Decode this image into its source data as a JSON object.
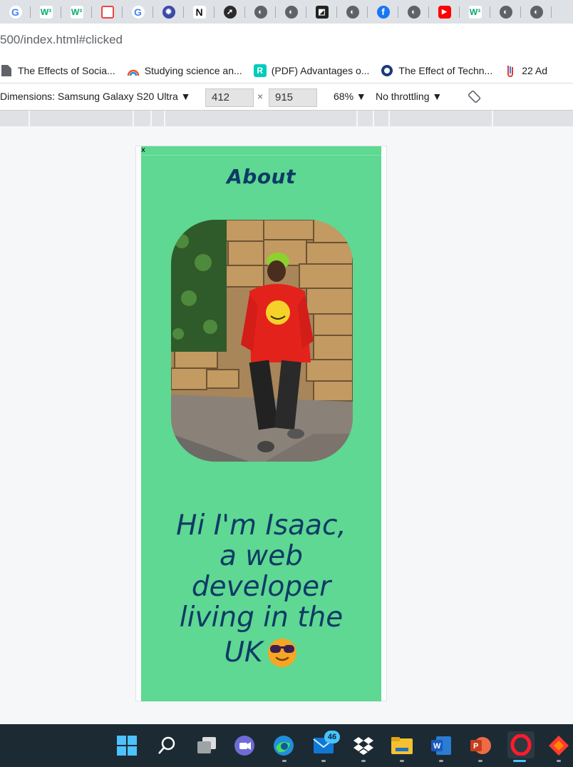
{
  "browser": {
    "url": "500/index.html#clicked",
    "tabs_icons": [
      "g-icon",
      "w3schools-icon",
      "w3schools-icon",
      "grid-icon",
      "google-icon",
      "gear-icon",
      "notion-icon",
      "dark-app-icon",
      "globe-icon",
      "globe-icon",
      "square-app-icon",
      "globe-icon",
      "facebook-icon",
      "globe-icon",
      "youtube-icon",
      "w3schools-icon",
      "globe-icon",
      "globe-icon",
      "globe-icon"
    ],
    "bookmarks": [
      {
        "label": "The Effects of Socia..."
      },
      {
        "label": "Studying science an..."
      },
      {
        "label": "(PDF) Advantages o..."
      },
      {
        "label": "The Effect of Techn..."
      },
      {
        "label": "22 Ad"
      }
    ]
  },
  "devtools": {
    "dimensions_label": "Dimensions: Samsung Galaxy S20 Ultra ▼",
    "width": "412",
    "times": "×",
    "height": "915",
    "zoom": "68% ▼",
    "throttling": "No throttling ▼"
  },
  "page": {
    "close_label": "x",
    "heading": "About",
    "hero_lines": [
      "Hi I'm Isaac,",
      "a web",
      "developer",
      "living in the"
    ],
    "hero_last": "UK",
    "colors": {
      "background": "#5ed892",
      "text": "#0e3a66"
    }
  },
  "taskbar": {
    "mail_badge": "46",
    "icons": [
      "windows-start-icon",
      "search-icon",
      "task-view-icon",
      "chat-icon",
      "edge-icon",
      "mail-icon",
      "dropbox-icon",
      "file-explorer-icon",
      "word-icon",
      "powerpoint-icon",
      "opera-icon",
      "app-icon"
    ]
  }
}
